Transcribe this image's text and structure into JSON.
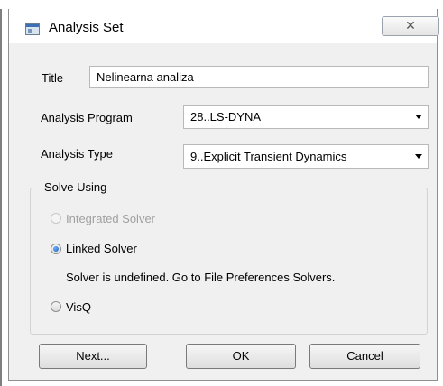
{
  "window": {
    "title": "Analysis Set",
    "close_glyph": "✕"
  },
  "form": {
    "title_label": "Title",
    "title_value": "Nelinearna analiza",
    "program_label": "Analysis Program",
    "program_value": "28..LS-DYNA",
    "type_label": "Analysis Type",
    "type_value": "9..Explicit Transient Dynamics"
  },
  "solve": {
    "group_label": "Solve Using",
    "integrated_label": "Integrated Solver",
    "linked_label": "Linked Solver",
    "linked_note": "Solver is undefined. Go to File Preferences Solvers.",
    "visq_label": "VisQ",
    "selected": "Linked Solver"
  },
  "buttons": {
    "next_label": "Next...",
    "ok_label": "OK",
    "cancel_label": "Cancel"
  }
}
